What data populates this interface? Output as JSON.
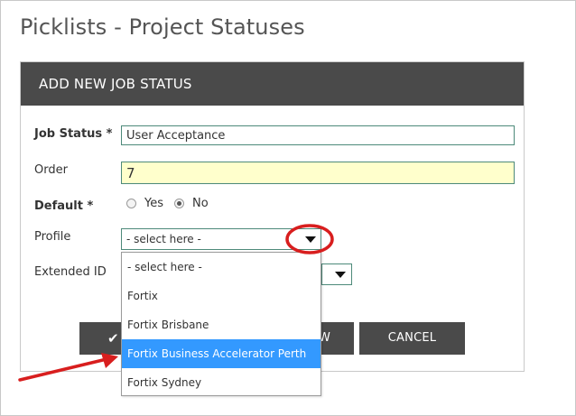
{
  "page": {
    "title": "Picklists - Project Statuses"
  },
  "panel": {
    "title": "ADD NEW JOB STATUS"
  },
  "form": {
    "job_status_label": "Job Status *",
    "job_status_value": "User Acceptance",
    "order_label": "Order",
    "order_value": "7",
    "default_label": "Default *",
    "default_yes": "Yes",
    "default_no": "No",
    "default_selected": "No",
    "profile_label": "Profile",
    "profile_value": "- select here -",
    "extended_id_label": "Extended ID"
  },
  "buttons": {
    "save_icon": "check-icon",
    "save_partial_text": "W",
    "cancel_label": "CANCEL"
  },
  "dropdown": {
    "options": [
      "- select here -",
      "Fortix",
      "Fortix Brisbane",
      "Fortix Business Accelerator Perth",
      "Fortix Sydney"
    ],
    "highlighted": "Fortix Business Accelerator Perth"
  },
  "colors": {
    "panel_header": "#4a4a4a",
    "highlight": "#3399ff",
    "annotation": "#e02020",
    "order_field_bg": "#ffffcc"
  }
}
